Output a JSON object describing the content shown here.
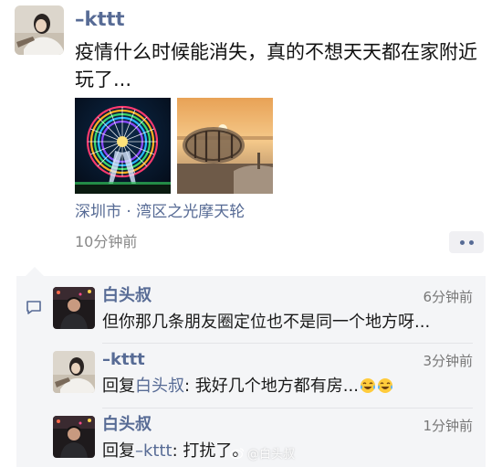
{
  "post": {
    "username": "–kttt",
    "text": "疫情什么时候能消失，真的不想天天都在家附近玩了...",
    "photos": [
      {
        "icon": "ferris-wheel-night-photo"
      },
      {
        "icon": "observation-cabin-sunset-photo"
      }
    ],
    "location": "深圳市 · 湾区之光摩天轮",
    "time": "10分钟前",
    "more_icon": "more-dots-icon"
  },
  "comments": [
    {
      "name": "白头叔",
      "time": "6分钟前",
      "text": "但你那几条朋友圈定位也不是同一个地方呀..."
    },
    {
      "name": "–kttt",
      "time": "3分钟前",
      "reply_prefix": "回复",
      "reply_to": "白头叔",
      "text": ": 我好几个地方都有房...",
      "emoji_icons": [
        "tears-of-joy-emoji-icon",
        "tears-of-joy-emoji-icon"
      ]
    },
    {
      "name": "白头叔",
      "time": "1分钟前",
      "reply_prefix": "回复",
      "reply_to": "–kttt",
      "text": ": 打扰了。"
    }
  ],
  "watermark": {
    "text": "@白头叔",
    "icon": "weibo-logo-icon"
  },
  "colors": {
    "link": "#576b95",
    "text": "#111111",
    "meta": "#888888",
    "comment_bg": "#f4f5f7"
  }
}
